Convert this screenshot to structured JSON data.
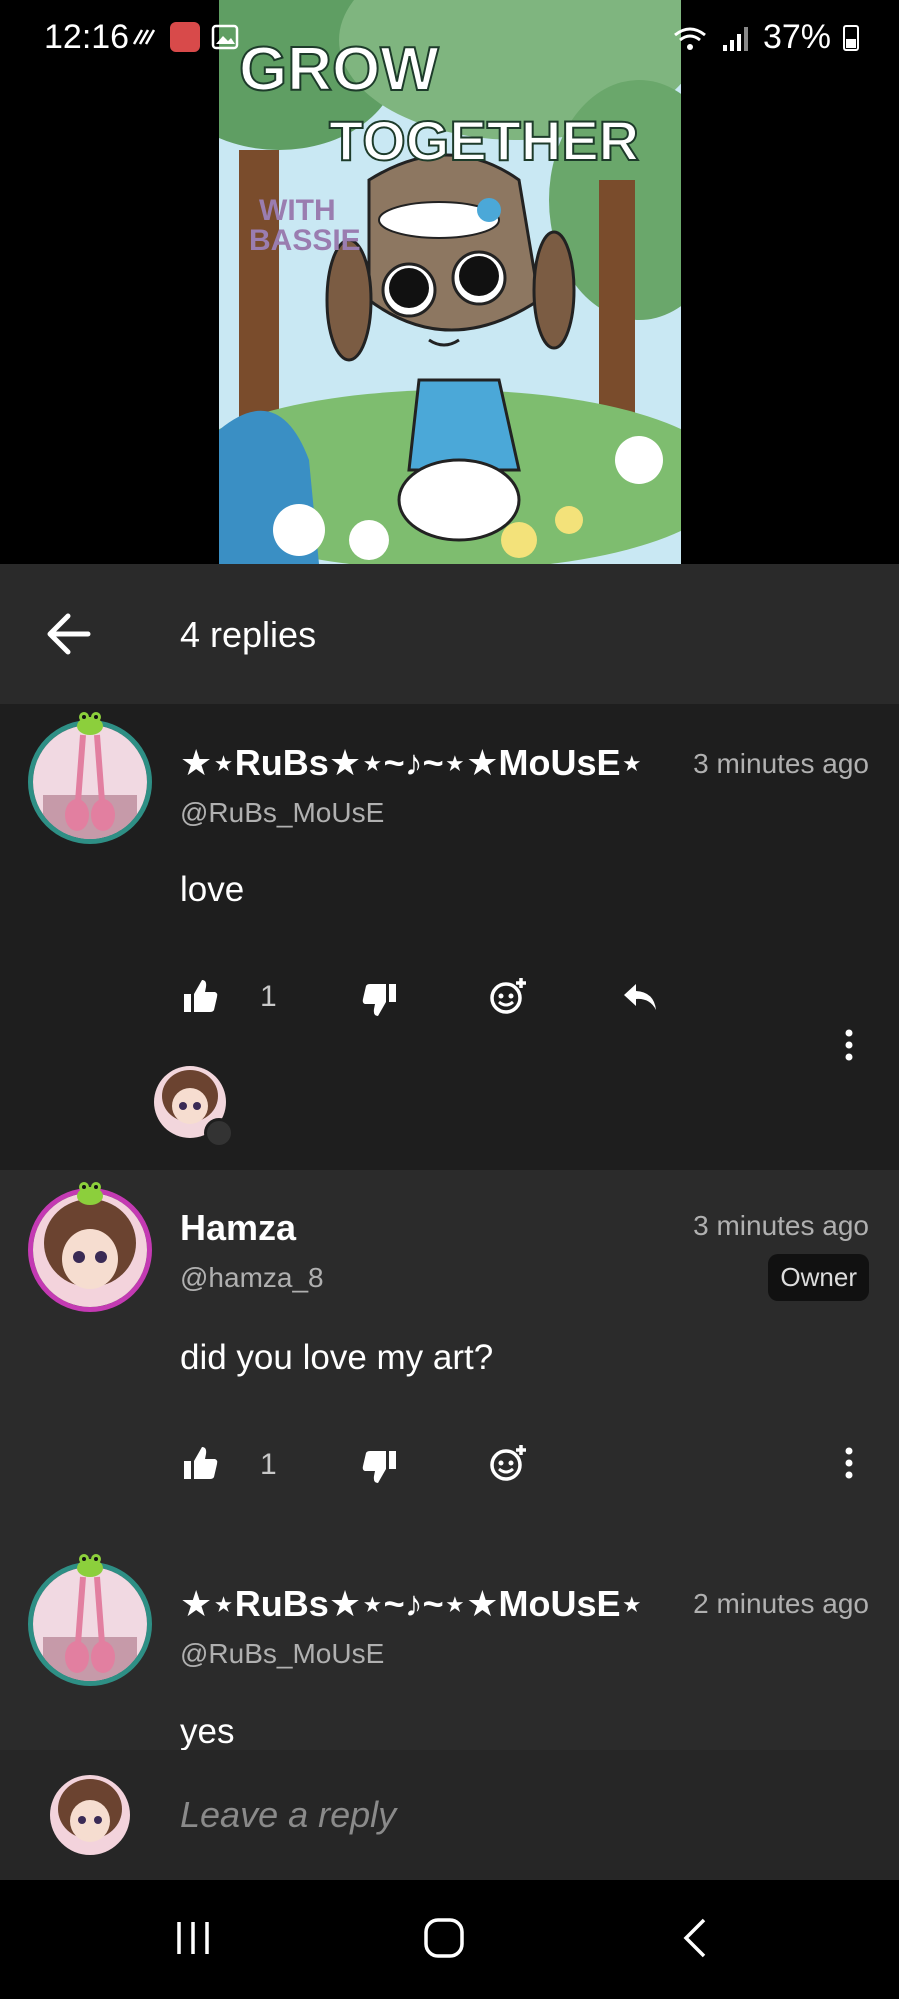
{
  "status_bar": {
    "time": "12:16",
    "battery": "37%"
  },
  "artwork": {
    "title_line1": "GROW",
    "title_line2": "TOGETHER",
    "subtitle_line1": "WITH",
    "subtitle_line2": "BASSIE"
  },
  "header": {
    "title": "4 replies"
  },
  "comments": [
    {
      "username": "★⋆RuBs★⋆~♪~⋆★MoUsE⋆",
      "handle": "@RuBs_MoUsE",
      "time": "3 minutes ago",
      "text": "love",
      "likes": "1"
    },
    {
      "username": "Hamza",
      "handle": "@hamza_8",
      "time": "3 minutes ago",
      "badge": "Owner",
      "text": "did you love my art?",
      "likes": "1"
    },
    {
      "username": "★⋆RuBs★⋆~♪~⋆★MoUsE⋆",
      "handle": "@RuBs_MoUsE",
      "time": "2 minutes ago",
      "text": "yes"
    }
  ],
  "reply_input": {
    "placeholder": "Leave a reply"
  },
  "icons": {
    "back": "arrow-left-icon",
    "like": "thumbs-up-icon",
    "dislike": "thumbs-down-icon",
    "emoji": "add-reaction-icon",
    "reply": "reply-icon",
    "more": "more-vertical-icon"
  },
  "colors": {
    "header_bg": "#2a2a2a",
    "main_comment_bg": "#1e1e1e",
    "list_bg": "#2b2b2b",
    "ring_teal": "#2e8f85",
    "ring_pink": "#c43ab3"
  }
}
